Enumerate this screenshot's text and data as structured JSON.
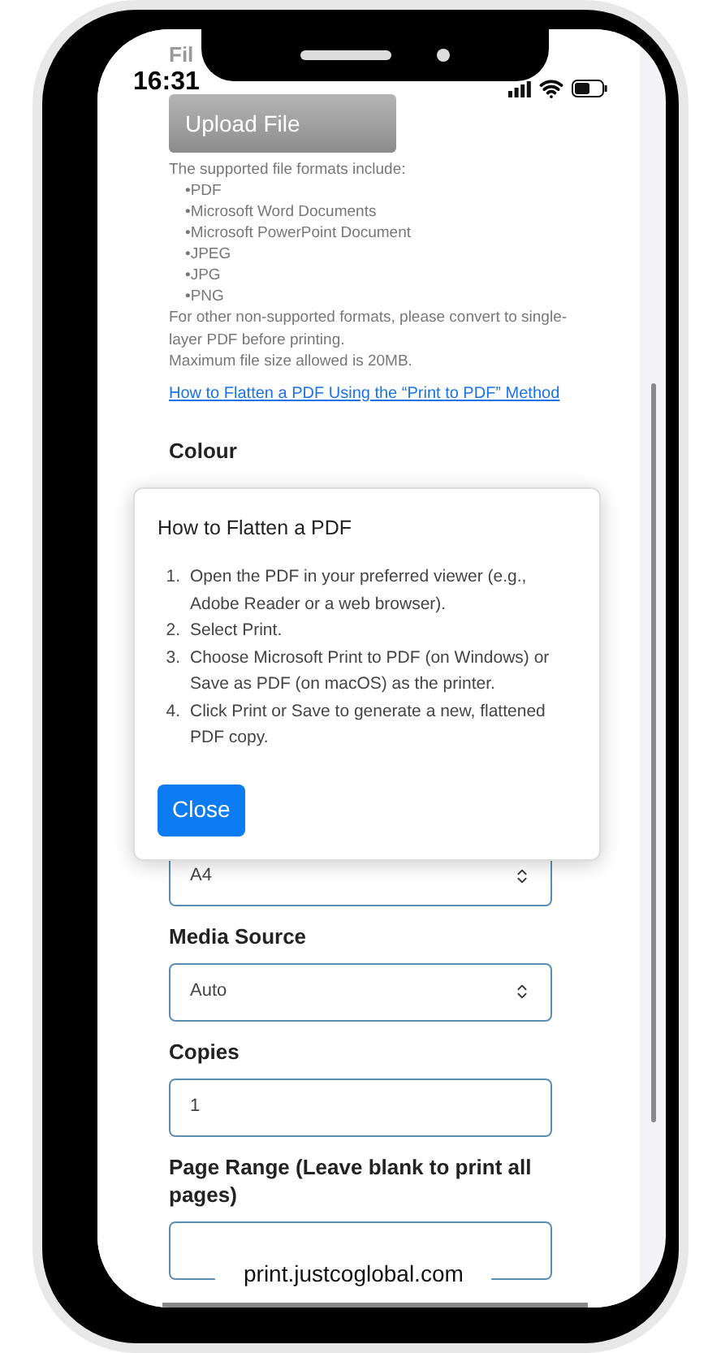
{
  "status_bar": {
    "time": "16:31"
  },
  "page": {
    "file_label": "Fil",
    "upload_button": {
      "label": "Upload File",
      "disabled": true
    },
    "formats_intro": "The supported file formats include:",
    "formats": [
      "•PDF",
      "•Microsoft Word Documents",
      "•Microsoft PowerPoint Document",
      "•JPEG",
      "•JPG",
      "•PNG"
    ],
    "notes": [
      "For other non-supported formats, please convert to single-layer PDF before printing.",
      "Maximum file size allowed is 20MB."
    ],
    "help_link": "How to Flatten a PDF Using the “Print to PDF” Method",
    "colour_label": "Colour",
    "fields": [
      {
        "kind": "select",
        "value": "A4"
      },
      {
        "kind": "select",
        "label": "Media Source",
        "value": "Auto"
      },
      {
        "kind": "input",
        "label": "Copies",
        "value": "1"
      },
      {
        "kind": "input",
        "label": "Page Range (Leave blank to print all pages)"
      }
    ]
  },
  "dialog": {
    "title": "How to Flatten a PDF",
    "steps": [
      {
        "number": "1.",
        "text": "Open the PDF in your preferred viewer (e.g., Adobe Reader or a web browser)."
      },
      {
        "number": "2.",
        "text": "Select Print."
      },
      {
        "number": "3.",
        "text": "Choose Microsoft Print to PDF (on Windows) or Save as PDF (on macOS) as the printer."
      },
      {
        "number": "4.",
        "text": "Click Print or Save to generate a new, flattened PDF copy."
      }
    ],
    "close_button": "Close"
  },
  "browser": {
    "url": "print.justcoglobal.com"
  }
}
